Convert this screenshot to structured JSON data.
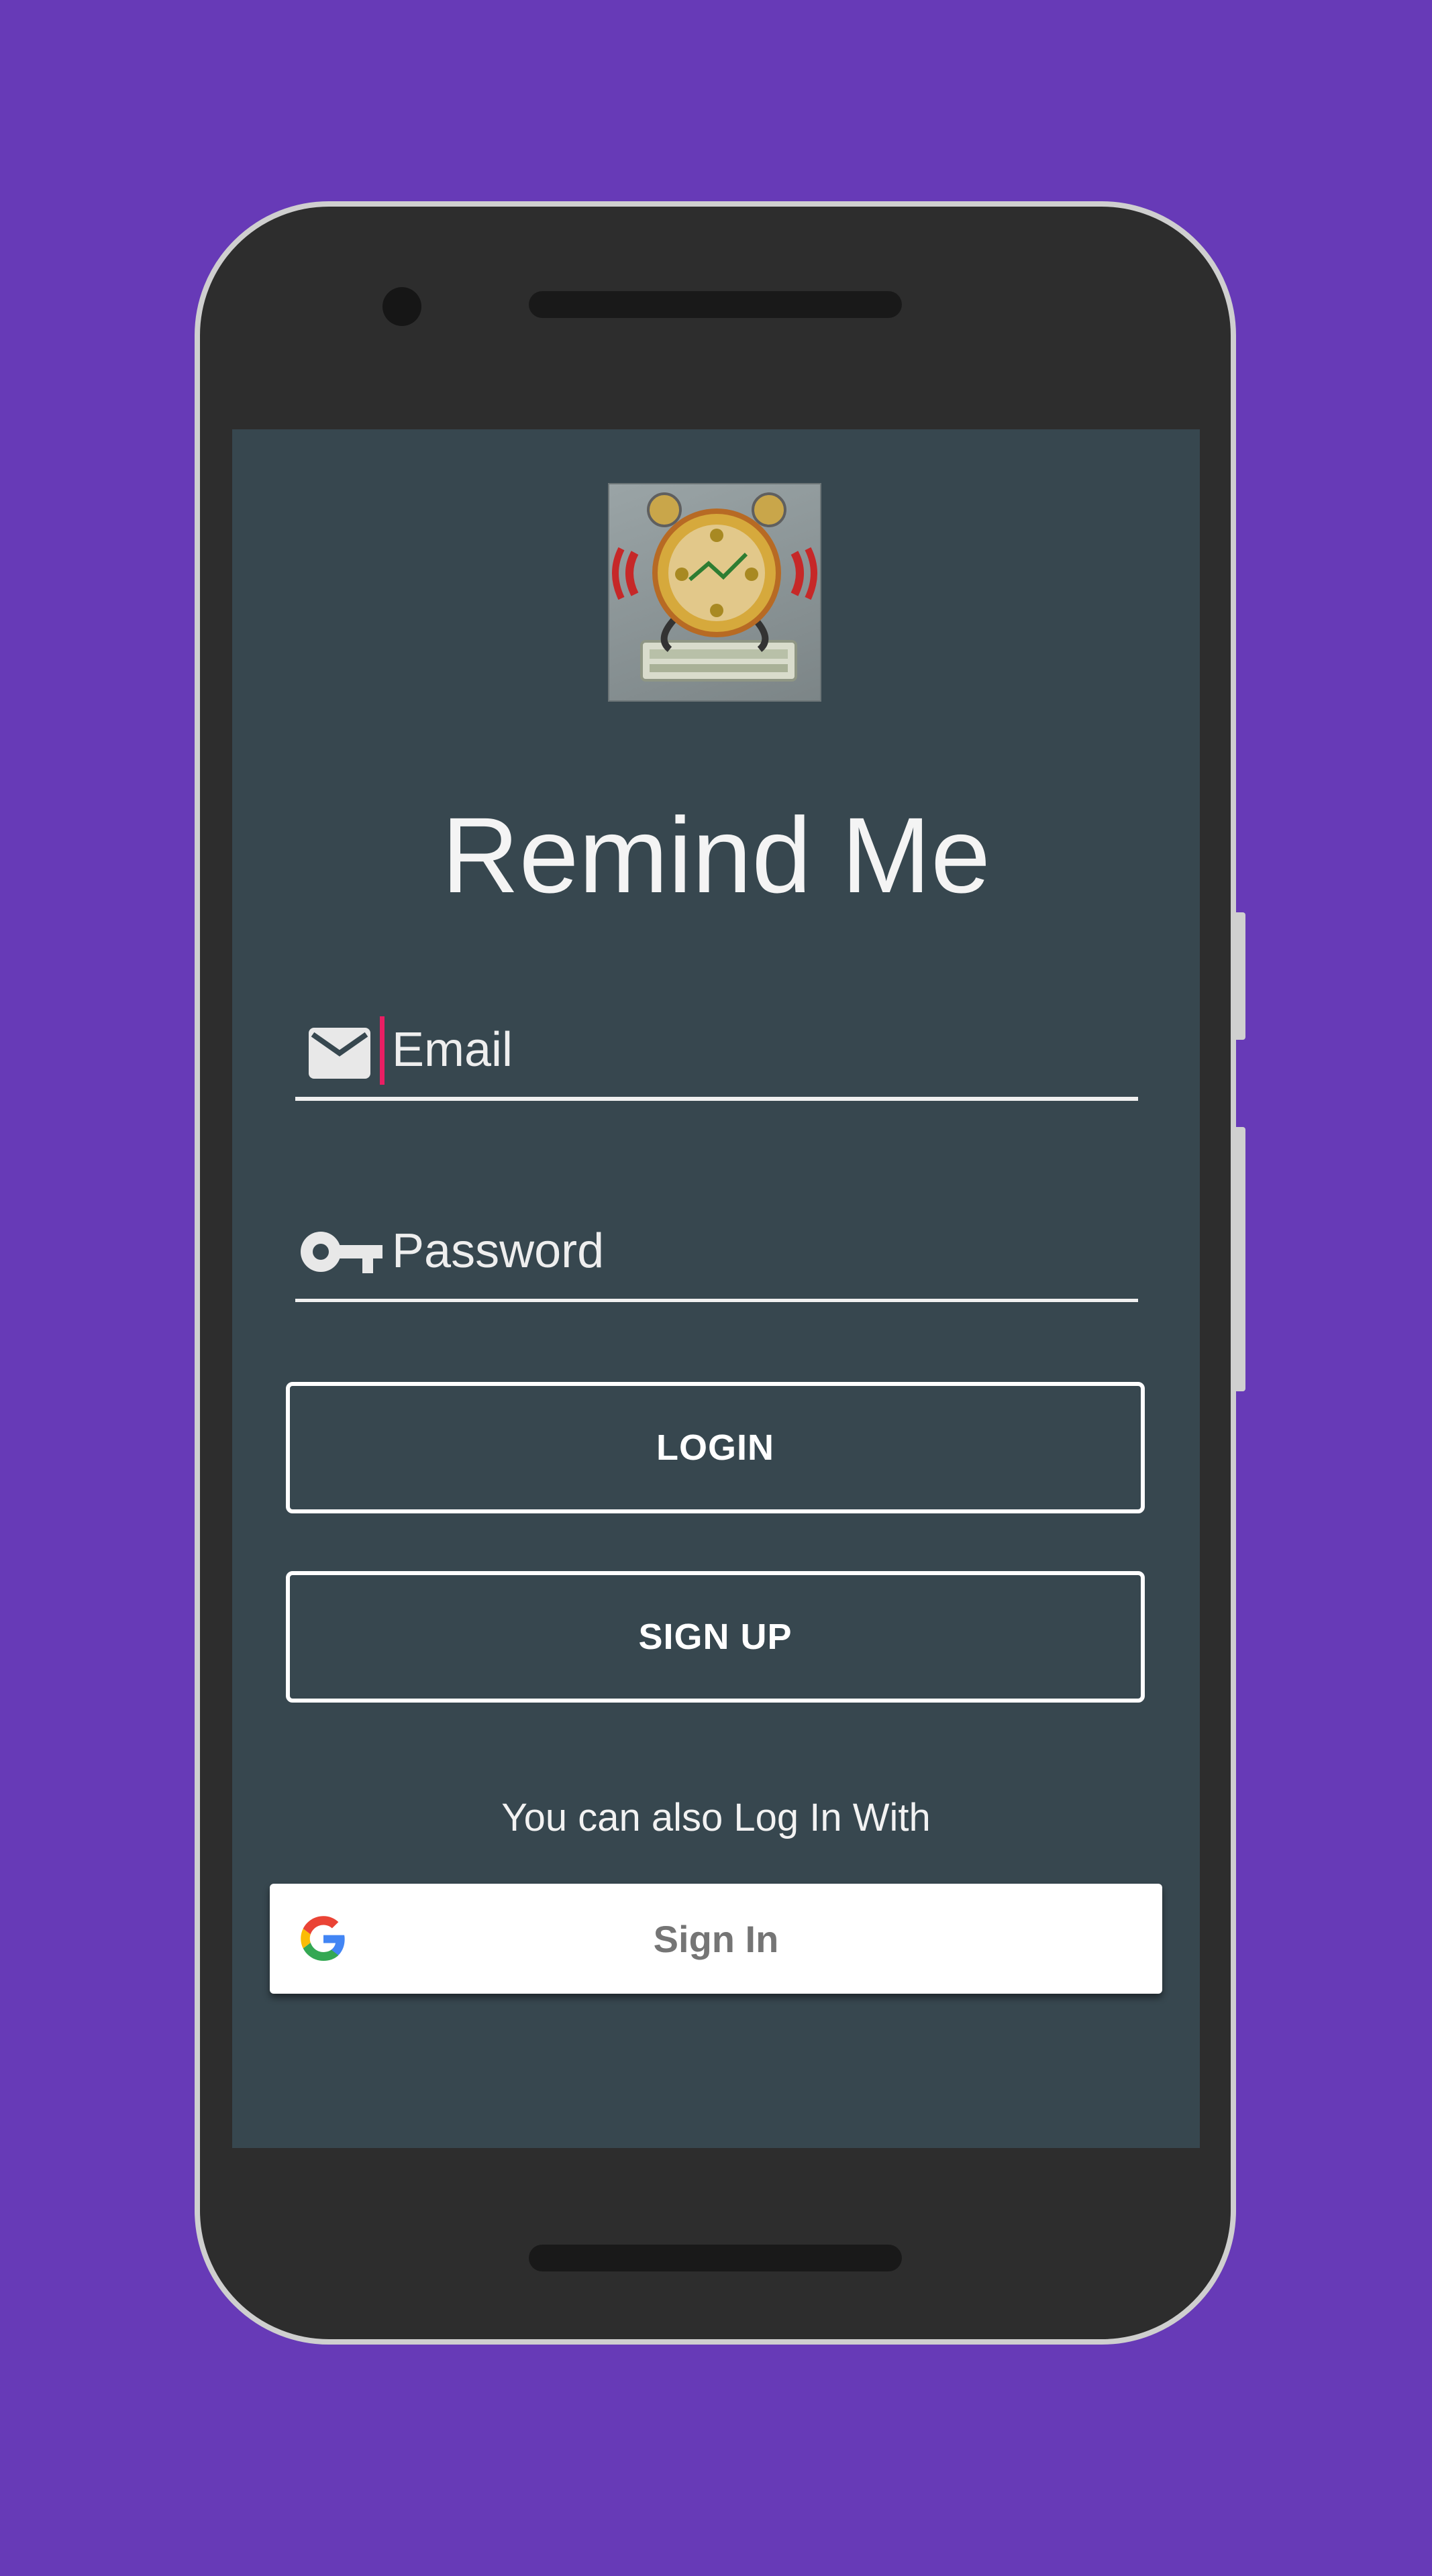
{
  "app": {
    "title": "Remind Me",
    "logo_icon": "alarm-clock-money-icon"
  },
  "login_form": {
    "email_placeholder": "Email",
    "email_icon": "mail-icon",
    "password_placeholder": "Password",
    "password_icon": "key-icon",
    "login_label": "LOGIN",
    "signup_label": "SIGN UP"
  },
  "social": {
    "prompt": "You can also Log In With",
    "google_signin_label": "Sign In",
    "google_icon": "google-g-icon"
  },
  "colors": {
    "background": "#673ab7",
    "screen": "#37474f",
    "cursor": "#e91e63",
    "text": "#ffffff"
  }
}
